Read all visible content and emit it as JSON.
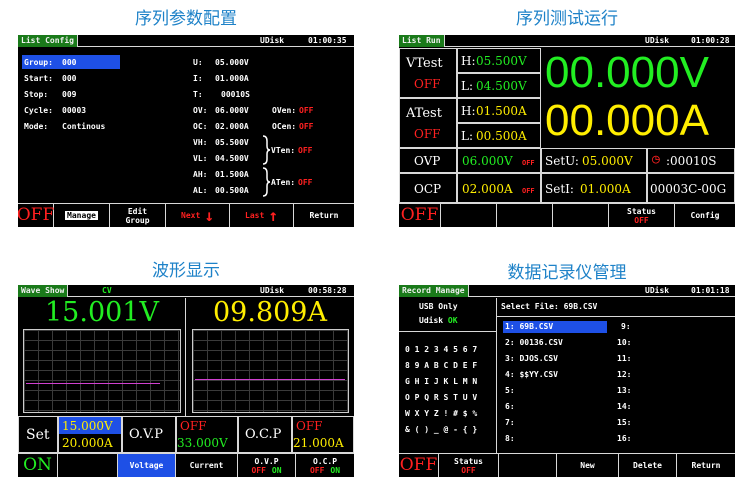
{
  "captions": {
    "list_config": "序列参数配置",
    "list_run": "序列测试运行",
    "wave_show": "波形显示",
    "record_manage": "数据记录仪管理"
  },
  "list_config": {
    "title": "List Config",
    "udisk": "UDisk",
    "time": "01:00:35",
    "left": [
      {
        "label": "Group:",
        "value": "000"
      },
      {
        "label": "Start:",
        "value": "000"
      },
      {
        "label": "Stop:",
        "value": "009"
      },
      {
        "label": "Cycle:",
        "value": "00003"
      },
      {
        "label": "Mode:",
        "value": "Continous"
      }
    ],
    "right": [
      {
        "label": "U:",
        "value": "05.000V"
      },
      {
        "label": "I:",
        "value": "01.000A"
      },
      {
        "label": "T:",
        "value": "00010S"
      },
      {
        "label": "OV:",
        "value": "06.000V"
      },
      {
        "label": "OC:",
        "value": "02.000A"
      },
      {
        "label": "VH:",
        "value": "05.500V"
      },
      {
        "label": "VL:",
        "value": "04.500V"
      },
      {
        "label": "AH:",
        "value": "01.500A"
      },
      {
        "label": "AL:",
        "value": "00.500A"
      }
    ],
    "oven": "OVen:",
    "oven_val": "OFF",
    "ocen": "OCen:",
    "ocen_val": "OFF",
    "vten": "VTen:",
    "vten_val": "OFF",
    "aten": "ATen:",
    "aten_val": "OFF",
    "buttons": {
      "off": "OFF",
      "manage": "Manage",
      "edit_group_1": "Edit",
      "edit_group_2": "Group",
      "next": "Next",
      "last": "Last",
      "return": "Return"
    }
  },
  "list_run": {
    "title": "List Run",
    "udisk": "UDisk",
    "time": "01:00:28",
    "vtest": "VTest",
    "vtest_state": "OFF",
    "h_v": "H:",
    "h_v_val": "05.500V",
    "l_v": "L:",
    "l_v_val": "04.500V",
    "big_v": "00.000V",
    "atest": "ATest",
    "atest_state": "OFF",
    "h_a": "H:",
    "h_a_val": "01.500A",
    "l_a": "L:",
    "l_a_val": "00.500A",
    "big_a": "00.000A",
    "ovp": "OVP",
    "ovp_val": "06.000V",
    "ovp_state": "OFF",
    "setu": "SetU:",
    "setu_val": "05.000V",
    "timer_val": ":00010S",
    "ocp": "OCP",
    "ocp_val": "02.000A",
    "ocp_state": "OFF",
    "seti": "SetI:",
    "seti_val": "01.000A",
    "counter": "00003C-00G",
    "buttons": {
      "off": "OFF",
      "status": "Status",
      "status_val": "OFF",
      "config": "Config"
    }
  },
  "wave_show": {
    "title": "Wave Show",
    "mode": "CV",
    "udisk": "UDisk",
    "time": "00:58:28",
    "voltage": "15.001V",
    "current": "09.809A",
    "set": "Set",
    "set_v": "15.000V",
    "set_a": "20.000A",
    "ovp": "O.V.P",
    "ovp_state": "OFF",
    "ovp_val": "33.000V",
    "ocp": "O.C.P",
    "ocp_state": "OFF",
    "ocp_val": "21.000A",
    "buttons": {
      "on": "ON",
      "voltage": "Voltage",
      "current": "Current",
      "ovp": "O.V.P",
      "ovp_off": "OFF",
      "ovp_on": "ON",
      "ocp": "O.C.P",
      "ocp_off": "OFF",
      "ocp_on": "ON"
    }
  },
  "record_manage": {
    "title": "Record Manage",
    "udisk": "UDisk",
    "time": "01:01:18",
    "usb_only": "USB Only",
    "udisk_ok_label": "Udisk",
    "udisk_ok": "OK",
    "select_file": "Select File: 69B.CSV",
    "keyboard": [
      "0 1 2 3 4 5 6 7",
      "8 9 A B C D E F",
      "G H I J K L M N",
      "O P Q R S T U V",
      "W X Y Z ! # $ %",
      "& ( ) _ @ - { }"
    ],
    "files_left": [
      "1: 69B.CSV",
      "2: 00136.CSV",
      "3: DJOS.CSV",
      "4: $$YY.CSV",
      "5:",
      "6:",
      "7:",
      "8:"
    ],
    "files_right": [
      "9:",
      "10:",
      "11:",
      "12:",
      "13:",
      "14:",
      "15:",
      "16:"
    ],
    "buttons": {
      "off": "OFF",
      "status": "Status",
      "status_val": "OFF",
      "new": "New",
      "delete": "Delete",
      "return": "Return"
    }
  }
}
